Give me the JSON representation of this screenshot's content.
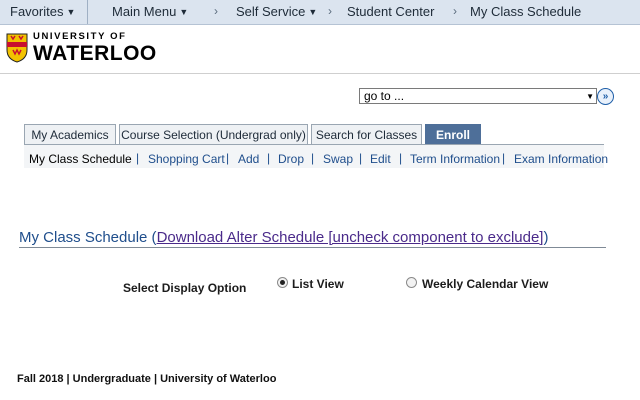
{
  "topbar": {
    "favorites": "Favorites",
    "main_menu": "Main Menu",
    "self_service": "Self Service",
    "student_center": "Student Center",
    "my_class_schedule": "My Class Schedule"
  },
  "logo": {
    "university_of": "UNIVERSITY OF",
    "waterloo": "WATERLOO"
  },
  "goto": {
    "value": "go to ...",
    "button": "»"
  },
  "tabs": [
    {
      "label": "My Academics"
    },
    {
      "label": "Course Selection (Undergrad only)"
    },
    {
      "label": "Search for Classes"
    },
    {
      "label": "Enroll"
    }
  ],
  "subnav": {
    "items": [
      {
        "label": "My Class Schedule"
      },
      {
        "label": "Shopping Cart"
      },
      {
        "label": "Add"
      },
      {
        "label": "Drop"
      },
      {
        "label": "Swap"
      },
      {
        "label": "Edit"
      },
      {
        "label": "Term Information"
      },
      {
        "label": "Exam Information"
      }
    ],
    "separator": "|"
  },
  "page_title": {
    "main": "My Class Schedule (",
    "link": "Download Alter Schedule [uncheck component to exclude]",
    "close": ")"
  },
  "display_option": {
    "label": "Select Display Option",
    "list_view": "List View",
    "calendar_view": "Weekly Calendar View",
    "selected": "List View"
  },
  "footer": {
    "text": "Fall 2018 | Undergraduate | University of Waterloo"
  },
  "colors": {
    "link": "#1f4e8c",
    "active_tab": "#4e6f99",
    "topbar": "#dbe4ef"
  }
}
